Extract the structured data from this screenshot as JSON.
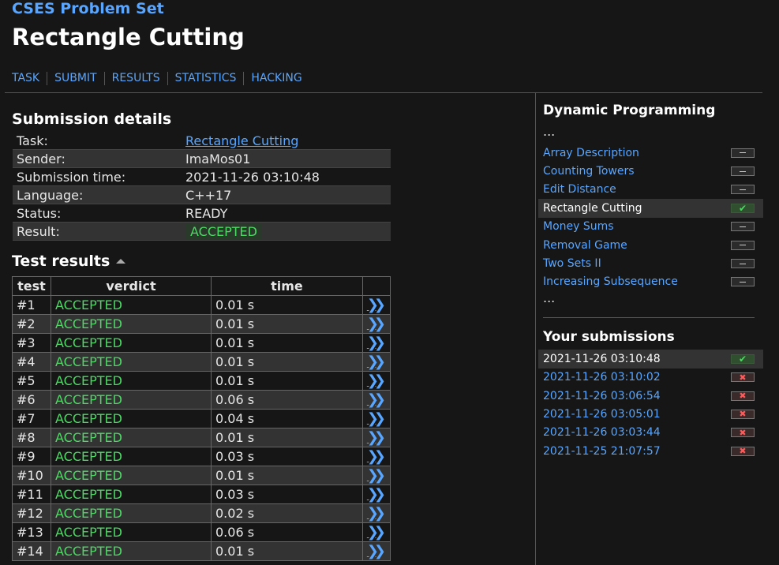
{
  "site": {
    "title": "CSES Problem Set"
  },
  "page": {
    "title": "Rectangle Cutting"
  },
  "nav": [
    "TASK",
    "SUBMIT",
    "RESULTS",
    "STATISTICS",
    "HACKING"
  ],
  "details": {
    "heading": "Submission details",
    "rows": [
      {
        "key": "Task:",
        "value": "Rectangle Cutting"
      },
      {
        "key": "Sender:",
        "value": "ImaMos01"
      },
      {
        "key": "Submission time:",
        "value": "2021-11-26 03:10:48"
      },
      {
        "key": "Language:",
        "value": "C++17"
      },
      {
        "key": "Status:",
        "value": "READY"
      },
      {
        "key": "Result:",
        "value": "ACCEPTED"
      }
    ]
  },
  "tests": {
    "heading": "Test results",
    "columns": [
      "test",
      "verdict",
      "time"
    ],
    "rows": [
      {
        "test": "#1",
        "verdict": "ACCEPTED",
        "time": "0.01 s"
      },
      {
        "test": "#2",
        "verdict": "ACCEPTED",
        "time": "0.01 s"
      },
      {
        "test": "#3",
        "verdict": "ACCEPTED",
        "time": "0.01 s"
      },
      {
        "test": "#4",
        "verdict": "ACCEPTED",
        "time": "0.01 s"
      },
      {
        "test": "#5",
        "verdict": "ACCEPTED",
        "time": "0.01 s"
      },
      {
        "test": "#6",
        "verdict": "ACCEPTED",
        "time": "0.06 s"
      },
      {
        "test": "#7",
        "verdict": "ACCEPTED",
        "time": "0.04 s"
      },
      {
        "test": "#8",
        "verdict": "ACCEPTED",
        "time": "0.01 s"
      },
      {
        "test": "#9",
        "verdict": "ACCEPTED",
        "time": "0.03 s"
      },
      {
        "test": "#10",
        "verdict": "ACCEPTED",
        "time": "0.01 s"
      },
      {
        "test": "#11",
        "verdict": "ACCEPTED",
        "time": "0.03 s"
      },
      {
        "test": "#12",
        "verdict": "ACCEPTED",
        "time": "0.02 s"
      },
      {
        "test": "#13",
        "verdict": "ACCEPTED",
        "time": "0.06 s"
      },
      {
        "test": "#14",
        "verdict": "ACCEPTED",
        "time": "0.01 s"
      }
    ]
  },
  "sidebar": {
    "section_title": "Dynamic Programming",
    "ellipsis": "...",
    "tasks": [
      {
        "label": "Array Description",
        "status": "todo"
      },
      {
        "label": "Counting Towers",
        "status": "todo"
      },
      {
        "label": "Edit Distance",
        "status": "todo"
      },
      {
        "label": "Rectangle Cutting",
        "status": "ok",
        "current": true
      },
      {
        "label": "Money Sums",
        "status": "todo"
      },
      {
        "label": "Removal Game",
        "status": "todo"
      },
      {
        "label": "Two Sets II",
        "status": "todo"
      },
      {
        "label": "Increasing Subsequence",
        "status": "todo"
      }
    ],
    "submissions_title": "Your submissions",
    "submissions": [
      {
        "time": "2021-11-26 03:10:48",
        "status": "ok",
        "current": true
      },
      {
        "time": "2021-11-26 03:10:02",
        "status": "fail"
      },
      {
        "time": "2021-11-26 03:06:54",
        "status": "fail"
      },
      {
        "time": "2021-11-26 03:05:01",
        "status": "fail"
      },
      {
        "time": "2021-11-26 03:03:44",
        "status": "fail"
      },
      {
        "time": "2021-11-25 21:07:57",
        "status": "fail"
      }
    ]
  },
  "colors": {
    "accent": "#58a6ff",
    "accepted": "#4cd964",
    "failed": "#ff5a5a",
    "background": "#161616"
  },
  "icons": {
    "ok": "check-icon",
    "fail": "cross-icon",
    "todo": "dash-icon",
    "details": "double-chevron-right-icon",
    "collapse": "caret-up-icon"
  }
}
